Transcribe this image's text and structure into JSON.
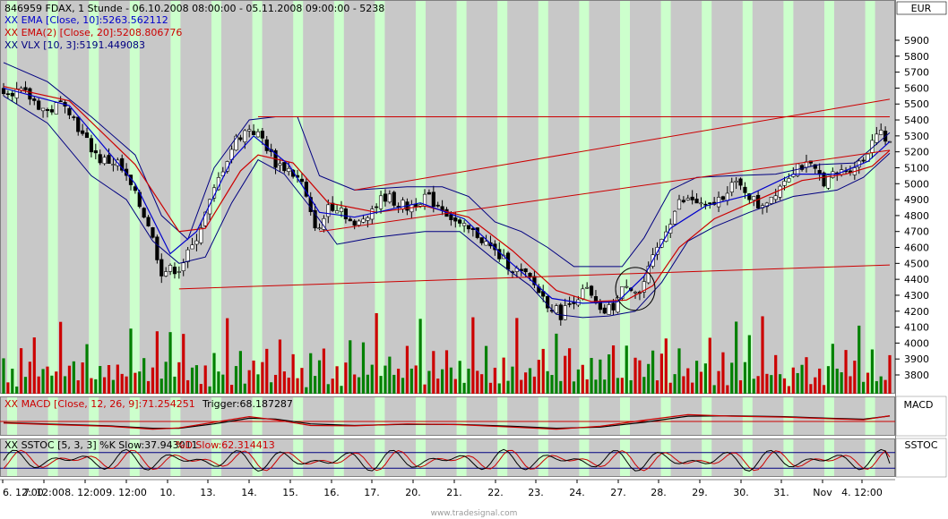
{
  "header": {
    "symbol_line": "846959  FDAX, 1 Stunde - 06.10.2008 08:00:00 - 05.11.2008 09:00:00 - 5238",
    "ema10_label": "XX EMA [Close, 10]:5263.562112",
    "ema20_label": "XX EMA(2) [Close, 20]:5208.806776",
    "vlx_label": "XX VLX [10, 3]:5191.449083"
  },
  "macd_panel": {
    "label_a": "XX MACD [Close, 12, 26, 9]:71.254251",
    "label_b": "Trigger:68.187287",
    "axis_title": "MACD"
  },
  "sstoc_panel": {
    "label_a": "XX SSTOC [5, 3, 3] %K Slow:37.943011",
    "label_b": "%D Slow:62.314413",
    "axis_title": "SSTOC"
  },
  "footer": {
    "watermark": "www.tradesignal.com"
  },
  "colors": {
    "panel_bg": "#c8c8c8",
    "session_band": "#ccffcc",
    "candle_up": "#ffffff",
    "candle_down": "#000000",
    "ema10": "#0000cc",
    "ema20": "#cc0000",
    "channel": "#cc0000",
    "volume_up": "#008000",
    "volume_down": "#cc0000",
    "hline": "#000080"
  },
  "chart_data": [
    {
      "type": "candlestick",
      "title": "846959  FDAX, 1 Stunde - 06.10.2008 08:00:00 - 05.11.2008 09:00:00 - 5238",
      "currency_label": "EUR",
      "y_ticks": [
        5900,
        5800,
        5700,
        5600,
        5500,
        5400,
        5300,
        5200,
        5100,
        5000,
        4900,
        4800,
        4700,
        4600,
        4500,
        4400,
        4300,
        4200,
        4100,
        4000,
        3900,
        3800
      ],
      "ylim": [
        3710,
        6000
      ],
      "x_labels": [
        "6. 12:00",
        "7. 12:00",
        "8. 12:00",
        "9. 12:00",
        "10.",
        "13.",
        "14.",
        "15.",
        "16.",
        "17.",
        "20.",
        "21.",
        "22.",
        "23.",
        "24.",
        "27.",
        "28.",
        "29.",
        "30.",
        "31.",
        "Nov",
        "4. 12:00"
      ],
      "close_path": [
        [
          0,
          5600
        ],
        [
          5,
          5560
        ],
        [
          10,
          5450
        ],
        [
          14,
          5520
        ],
        [
          18,
          5300
        ],
        [
          22,
          5150
        ],
        [
          26,
          5130
        ],
        [
          29,
          4980
        ],
        [
          33,
          4750
        ],
        [
          36,
          4450
        ],
        [
          40,
          4470
        ],
        [
          43,
          4600
        ],
        [
          47,
          4880
        ],
        [
          50,
          5100
        ],
        [
          53,
          5280
        ],
        [
          56,
          5350
        ],
        [
          59,
          5280
        ],
        [
          62,
          5130
        ],
        [
          65,
          5090
        ],
        [
          68,
          5000
        ],
        [
          70,
          4800
        ],
        [
          72,
          4700
        ],
        [
          74,
          4870
        ],
        [
          77,
          4850
        ],
        [
          80,
          4720
        ],
        [
          83,
          4820
        ],
        [
          87,
          4920
        ],
        [
          92,
          4850
        ],
        [
          96,
          4920
        ],
        [
          100,
          4850
        ],
        [
          104,
          4730
        ],
        [
          108,
          4680
        ],
        [
          112,
          4570
        ],
        [
          116,
          4470
        ],
        [
          120,
          4400
        ],
        [
          124,
          4250
        ],
        [
          127,
          4180
        ],
        [
          130,
          4280
        ],
        [
          133,
          4330
        ],
        [
          136,
          4180
        ],
        [
          139,
          4230
        ],
        [
          142,
          4380
        ],
        [
          145,
          4310
        ],
        [
          148,
          4520
        ],
        [
          151,
          4720
        ],
        [
          154,
          4880
        ],
        [
          157,
          4900
        ],
        [
          160,
          4840
        ],
        [
          163,
          4900
        ],
        [
          166,
          5000
        ],
        [
          169,
          4960
        ],
        [
          172,
          4860
        ],
        [
          175,
          4920
        ],
        [
          178,
          5030
        ],
        [
          181,
          5120
        ],
        [
          184,
          5100
        ],
        [
          187,
          5020
        ],
        [
          190,
          5060
        ],
        [
          193,
          5100
        ],
        [
          196,
          5150
        ],
        [
          199,
          5340
        ],
        [
          202,
          5238
        ]
      ],
      "bar_count": 203,
      "ema10": [
        [
          0,
          5600
        ],
        [
          15,
          5490
        ],
        [
          30,
          5000
        ],
        [
          38,
          4560
        ],
        [
          44,
          4700
        ],
        [
          52,
          5150
        ],
        [
          57,
          5300
        ],
        [
          65,
          5120
        ],
        [
          72,
          4820
        ],
        [
          80,
          4790
        ],
        [
          95,
          4880
        ],
        [
          105,
          4780
        ],
        [
          115,
          4520
        ],
        [
          125,
          4280
        ],
        [
          132,
          4250
        ],
        [
          140,
          4260
        ],
        [
          146,
          4420
        ],
        [
          152,
          4720
        ],
        [
          160,
          4860
        ],
        [
          170,
          4930
        ],
        [
          180,
          5060
        ],
        [
          190,
          5060
        ],
        [
          197,
          5140
        ],
        [
          202,
          5264
        ]
      ],
      "ema20": [
        [
          0,
          5610
        ],
        [
          15,
          5520
        ],
        [
          30,
          5120
        ],
        [
          40,
          4700
        ],
        [
          46,
          4720
        ],
        [
          54,
          5080
        ],
        [
          58,
          5180
        ],
        [
          66,
          5130
        ],
        [
          74,
          4880
        ],
        [
          85,
          4820
        ],
        [
          96,
          4860
        ],
        [
          106,
          4790
        ],
        [
          116,
          4580
        ],
        [
          126,
          4330
        ],
        [
          134,
          4260
        ],
        [
          142,
          4270
        ],
        [
          148,
          4360
        ],
        [
          154,
          4600
        ],
        [
          162,
          4780
        ],
        [
          172,
          4900
        ],
        [
          182,
          5020
        ],
        [
          192,
          5060
        ],
        [
          198,
          5110
        ],
        [
          202,
          5209
        ]
      ],
      "vlx_upper": [
        [
          0,
          5760
        ],
        [
          10,
          5640
        ],
        [
          20,
          5420
        ],
        [
          30,
          5180
        ],
        [
          36,
          4800
        ],
        [
          42,
          4650
        ],
        [
          48,
          5100
        ],
        [
          56,
          5400
        ],
        [
          62,
          5420
        ],
        [
          67,
          5420
        ],
        [
          72,
          5050
        ],
        [
          80,
          4960
        ],
        [
          92,
          4980
        ],
        [
          100,
          4980
        ],
        [
          106,
          4920
        ],
        [
          112,
          4760
        ],
        [
          118,
          4700
        ],
        [
          124,
          4600
        ],
        [
          130,
          4480
        ],
        [
          136,
          4480
        ],
        [
          141,
          4480
        ],
        [
          146,
          4660
        ],
        [
          152,
          4960
        ],
        [
          158,
          5040
        ],
        [
          166,
          5050
        ],
        [
          176,
          5060
        ],
        [
          186,
          5120
        ],
        [
          194,
          5130
        ],
        [
          202,
          5320
        ]
      ],
      "vlx_lower": [
        [
          0,
          5550
        ],
        [
          10,
          5380
        ],
        [
          20,
          5050
        ],
        [
          28,
          4900
        ],
        [
          34,
          4640
        ],
        [
          40,
          4500
        ],
        [
          46,
          4540
        ],
        [
          52,
          4880
        ],
        [
          58,
          5150
        ],
        [
          64,
          5060
        ],
        [
          70,
          4850
        ],
        [
          76,
          4620
        ],
        [
          84,
          4660
        ],
        [
          96,
          4700
        ],
        [
          104,
          4700
        ],
        [
          112,
          4520
        ],
        [
          120,
          4360
        ],
        [
          126,
          4180
        ],
        [
          132,
          4160
        ],
        [
          138,
          4170
        ],
        [
          144,
          4200
        ],
        [
          150,
          4380
        ],
        [
          156,
          4640
        ],
        [
          162,
          4730
        ],
        [
          170,
          4820
        ],
        [
          180,
          4920
        ],
        [
          190,
          4960
        ],
        [
          196,
          5040
        ],
        [
          202,
          5191
        ]
      ],
      "channels": [
        [
          [
            40,
            4340
          ],
          [
            202,
            4490
          ]
        ],
        [
          [
            72,
            4700
          ],
          [
            202,
            5210
          ]
        ],
        [
          [
            80,
            4960
          ],
          [
            202,
            5530
          ]
        ],
        [
          [
            58,
            5420
          ],
          [
            202,
            5420
          ]
        ]
      ],
      "circle_annotation": {
        "bar": 144,
        "price": 4340
      },
      "volume_pattern": [
        38,
        18,
        28,
        12,
        45,
        22,
        30,
        60,
        16,
        25,
        40,
        14,
        35,
        55,
        20,
        26,
        48,
        15,
        32,
        75,
        19,
        24
      ]
    },
    {
      "type": "line",
      "name": "MACD",
      "title": "XX MACD [Close, 12, 26, 9]:71.254251 Trigger:68.187287",
      "zero_line": 0,
      "macd": [
        [
          0,
          -20
        ],
        [
          12,
          -40
        ],
        [
          24,
          -60
        ],
        [
          34,
          -95
        ],
        [
          40,
          -80
        ],
        [
          48,
          -10
        ],
        [
          56,
          60
        ],
        [
          62,
          20
        ],
        [
          70,
          -50
        ],
        [
          80,
          -55
        ],
        [
          92,
          -30
        ],
        [
          104,
          -40
        ],
        [
          116,
          -70
        ],
        [
          126,
          -95
        ],
        [
          136,
          -60
        ],
        [
          146,
          15
        ],
        [
          156,
          85
        ],
        [
          166,
          65
        ],
        [
          178,
          55
        ],
        [
          188,
          35
        ],
        [
          196,
          20
        ],
        [
          202,
          71
        ]
      ],
      "trigger": [
        [
          0,
          -15
        ],
        [
          12,
          -35
        ],
        [
          24,
          -55
        ],
        [
          34,
          -85
        ],
        [
          40,
          -85
        ],
        [
          48,
          -30
        ],
        [
          56,
          40
        ],
        [
          62,
          30
        ],
        [
          70,
          -30
        ],
        [
          80,
          -50
        ],
        [
          92,
          -35
        ],
        [
          104,
          -38
        ],
        [
          116,
          -60
        ],
        [
          126,
          -85
        ],
        [
          136,
          -70
        ],
        [
          146,
          -10
        ],
        [
          156,
          65
        ],
        [
          166,
          70
        ],
        [
          178,
          60
        ],
        [
          188,
          40
        ],
        [
          196,
          28
        ],
        [
          202,
          68
        ]
      ]
    },
    {
      "type": "line",
      "name": "SSTOC",
      "title": "XX SSTOC [5, 3, 3] %K Slow:37.943011 %D Slow:62.314413",
      "levels": [
        80,
        20
      ],
      "k_last": 37.943011,
      "d_last": 62.314413
    }
  ]
}
